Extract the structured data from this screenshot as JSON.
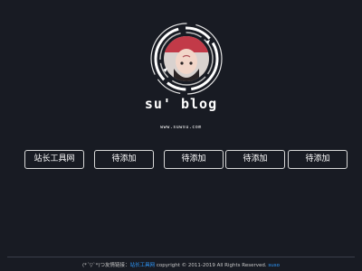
{
  "header": {
    "title": "su' blog",
    "url": "www.suwsu.com"
  },
  "links": [
    {
      "label": "站长工具网"
    },
    {
      "label": "待添加"
    },
    {
      "label": "待添加"
    },
    {
      "label": "待添加"
    },
    {
      "label": "待添加"
    }
  ],
  "footer": {
    "prefix": "(*´▽`*)つ友情链接：",
    "link": "站长工具网",
    "copyright": " copyright © 2011-2019 All Rights Reserved. ",
    "author": "suso"
  },
  "colors": {
    "background": "#181b23",
    "text": "#ffffff",
    "link_accent": "#2f9bff",
    "button_border": "#d8d8d8"
  },
  "icons": {
    "avatar": "avatar-photo-with-rotating-ring"
  }
}
